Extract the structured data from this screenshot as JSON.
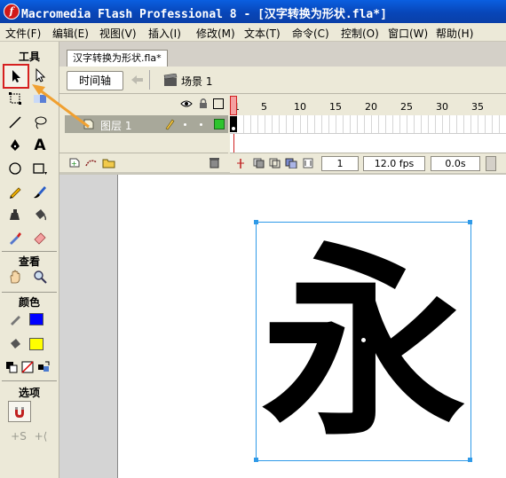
{
  "window": {
    "title": "Macromedia Flash Professional 8 - [汉字转换为形状.fla*]"
  },
  "menu": [
    "文件(F)",
    "编辑(E)",
    "视图(V)",
    "插入(I)",
    "修改(M)",
    "文本(T)",
    "命令(C)",
    "控制(O)",
    "窗口(W)",
    "帮助(H)"
  ],
  "tools": {
    "header": "工具",
    "view_header": "查看",
    "colors_header": "颜色",
    "options_header": "选项",
    "stroke_color": "#0000ff",
    "fill_color": "#ffff00"
  },
  "document": {
    "tab_label": "汉字转换为形状.fla*",
    "timeline_button": "时间轴",
    "scene_label": "场景 1"
  },
  "timeline": {
    "frame_numbers": [
      "1",
      "5",
      "10",
      "15",
      "20",
      "25",
      "30",
      "35"
    ],
    "layer_name": "图层 1",
    "current_frame": "1",
    "frame_rate": "12.0 fps",
    "elapsed_time": "0.0s"
  },
  "stage": {
    "character": "永"
  }
}
